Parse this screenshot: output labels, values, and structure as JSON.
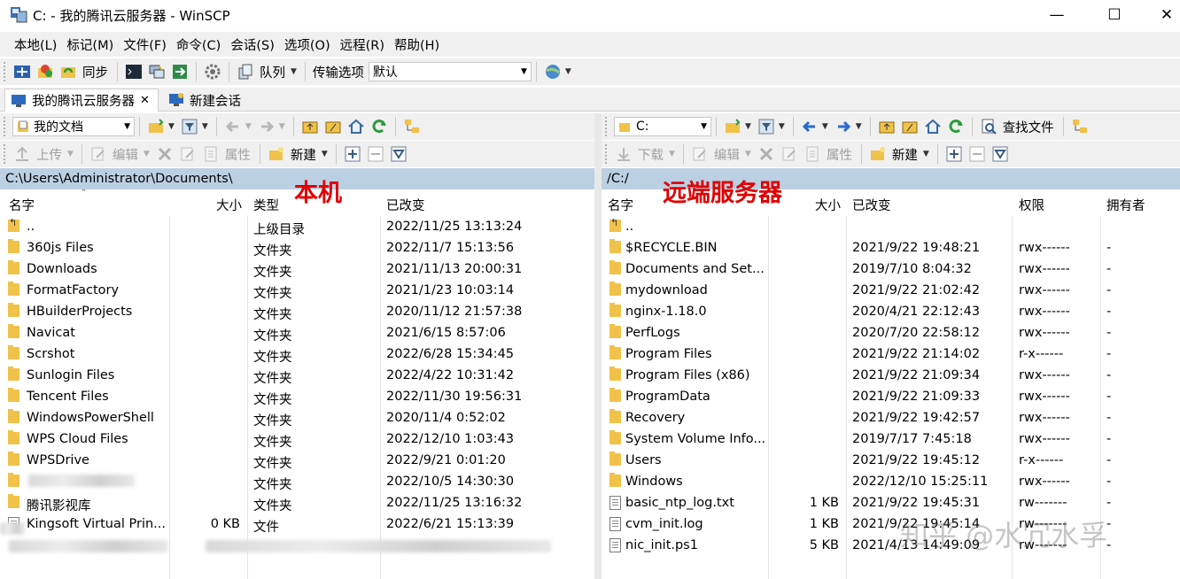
{
  "window": {
    "title": "C: - 我的腾讯云服务器 - WinSCP",
    "minimize": "—",
    "maximize": "☐",
    "close": "✕"
  },
  "menu": [
    "本地(L)",
    "标记(M)",
    "文件(F)",
    "命令(C)",
    "会话(S)",
    "选项(O)",
    "远程(R)",
    "帮助(H)"
  ],
  "toolbar": {
    "sync": "同步",
    "queue": "队列",
    "transfer_label": "传输选项",
    "transfer_value": "默认"
  },
  "tabs": {
    "session": "我的腾讯云服务器",
    "close": "✕",
    "new_session": "新建会话"
  },
  "local": {
    "location": "我的文档",
    "actions": {
      "upload": "上传",
      "edit": "编辑",
      "properties": "属性",
      "new": "新建"
    },
    "path": "C:\\Users\\Administrator\\Documents\\",
    "annotation": "本机",
    "columns": {
      "name": "名字",
      "size": "大小",
      "type": "类型",
      "changed": "已改变"
    },
    "rows": [
      {
        "name": "..",
        "size": "",
        "type": "上级目录",
        "changed": "2022/11/25  13:13:24",
        "icon": "updir"
      },
      {
        "name": "360js Files",
        "size": "",
        "type": "文件夹",
        "changed": "2022/11/7  15:13:56",
        "icon": "folder"
      },
      {
        "name": "Downloads",
        "size": "",
        "type": "文件夹",
        "changed": "2021/11/13  20:00:31",
        "icon": "folder"
      },
      {
        "name": "FormatFactory",
        "size": "",
        "type": "文件夹",
        "changed": "2021/1/23  10:03:14",
        "icon": "folder"
      },
      {
        "name": "HBuilderProjects",
        "size": "",
        "type": "文件夹",
        "changed": "2020/11/12  21:57:38",
        "icon": "folder"
      },
      {
        "name": "Navicat",
        "size": "",
        "type": "文件夹",
        "changed": "2021/6/15  8:57:06",
        "icon": "folder"
      },
      {
        "name": "Scrshot",
        "size": "",
        "type": "文件夹",
        "changed": "2022/6/28  15:34:45",
        "icon": "folder"
      },
      {
        "name": "Sunlogin Files",
        "size": "",
        "type": "文件夹",
        "changed": "2022/4/22  10:31:42",
        "icon": "folder"
      },
      {
        "name": "Tencent Files",
        "size": "",
        "type": "文件夹",
        "changed": "2022/11/30  19:56:31",
        "icon": "folder"
      },
      {
        "name": "WindowsPowerShell",
        "size": "",
        "type": "文件夹",
        "changed": "2020/11/4  0:52:02",
        "icon": "folder"
      },
      {
        "name": "WPS Cloud Files",
        "size": "",
        "type": "文件夹",
        "changed": "2022/12/10  1:03:43",
        "icon": "folder"
      },
      {
        "name": "WPSDrive",
        "size": "",
        "type": "文件夹",
        "changed": "2022/9/21  0:01:20",
        "icon": "folder"
      },
      {
        "name": "",
        "size": "",
        "type": "文件夹",
        "changed": "2022/10/5  14:30:30",
        "icon": "folder"
      },
      {
        "name": "腾讯影视库",
        "size": "",
        "type": "文件夹",
        "changed": "2022/11/25  13:16:32",
        "icon": "folder"
      },
      {
        "name": "Kingsoft Virtual Prin...",
        "size": "0 KB",
        "type": "文件",
        "changed": "2022/6/21  15:13:39",
        "icon": "file"
      }
    ]
  },
  "remote": {
    "location": "C:",
    "find_files": "查找文件",
    "actions": {
      "download": "下载",
      "edit": "编辑",
      "properties": "属性",
      "new": "新建"
    },
    "path": "/C:/",
    "annotation": "远端服务器",
    "columns": {
      "name": "名字",
      "size": "大小",
      "changed": "已改变",
      "rights": "权限",
      "owner": "拥有者"
    },
    "rows": [
      {
        "name": "..",
        "size": "",
        "changed": "",
        "rights": "",
        "owner": "",
        "icon": "updir"
      },
      {
        "name": "$RECYCLE.BIN",
        "size": "",
        "changed": "2021/9/22 19:48:21",
        "rights": "rwx------",
        "owner": "-",
        "icon": "folder"
      },
      {
        "name": "Documents and Set...",
        "size": "",
        "changed": "2019/7/10 8:04:32",
        "rights": "rwx------",
        "owner": "-",
        "icon": "folder"
      },
      {
        "name": "mydownload",
        "size": "",
        "changed": "2021/9/22 21:02:42",
        "rights": "rwx------",
        "owner": "-",
        "icon": "folder"
      },
      {
        "name": "nginx-1.18.0",
        "size": "",
        "changed": "2020/4/21 22:12:43",
        "rights": "rwx------",
        "owner": "-",
        "icon": "folder"
      },
      {
        "name": "PerfLogs",
        "size": "",
        "changed": "2020/7/20 22:58:12",
        "rights": "rwx------",
        "owner": "-",
        "icon": "folder"
      },
      {
        "name": "Program Files",
        "size": "",
        "changed": "2021/9/22 21:14:02",
        "rights": "r-x------",
        "owner": "-",
        "icon": "folder"
      },
      {
        "name": "Program Files (x86)",
        "size": "",
        "changed": "2021/9/22 21:09:34",
        "rights": "rwx------",
        "owner": "-",
        "icon": "folder"
      },
      {
        "name": "ProgramData",
        "size": "",
        "changed": "2021/9/22 21:09:33",
        "rights": "rwx------",
        "owner": "-",
        "icon": "folder"
      },
      {
        "name": "Recovery",
        "size": "",
        "changed": "2021/9/22 19:42:57",
        "rights": "rwx------",
        "owner": "-",
        "icon": "folder"
      },
      {
        "name": "System Volume Info...",
        "size": "",
        "changed": "2019/7/17 7:45:18",
        "rights": "rwx------",
        "owner": "-",
        "icon": "folder"
      },
      {
        "name": "Users",
        "size": "",
        "changed": "2021/9/22 19:45:12",
        "rights": "r-x------",
        "owner": "-",
        "icon": "folder"
      },
      {
        "name": "Windows",
        "size": "",
        "changed": "2022/12/10 15:25:11",
        "rights": "rwx------",
        "owner": "-",
        "icon": "folder"
      },
      {
        "name": "basic_ntp_log.txt",
        "size": "1 KB",
        "changed": "2021/9/22 19:45:31",
        "rights": "rw-------",
        "owner": "-",
        "icon": "file"
      },
      {
        "name": "cvm_init.log",
        "size": "1 KB",
        "changed": "2021/9/22 19:45:14",
        "rights": "rw-------",
        "owner": "-",
        "icon": "file"
      },
      {
        "name": "nic_init.ps1",
        "size": "5 KB",
        "changed": "2021/4/13 14:49:09",
        "rights": "rw-------",
        "owner": "-",
        "icon": "file"
      }
    ]
  },
  "watermark": "知乎 @水冗水孚"
}
